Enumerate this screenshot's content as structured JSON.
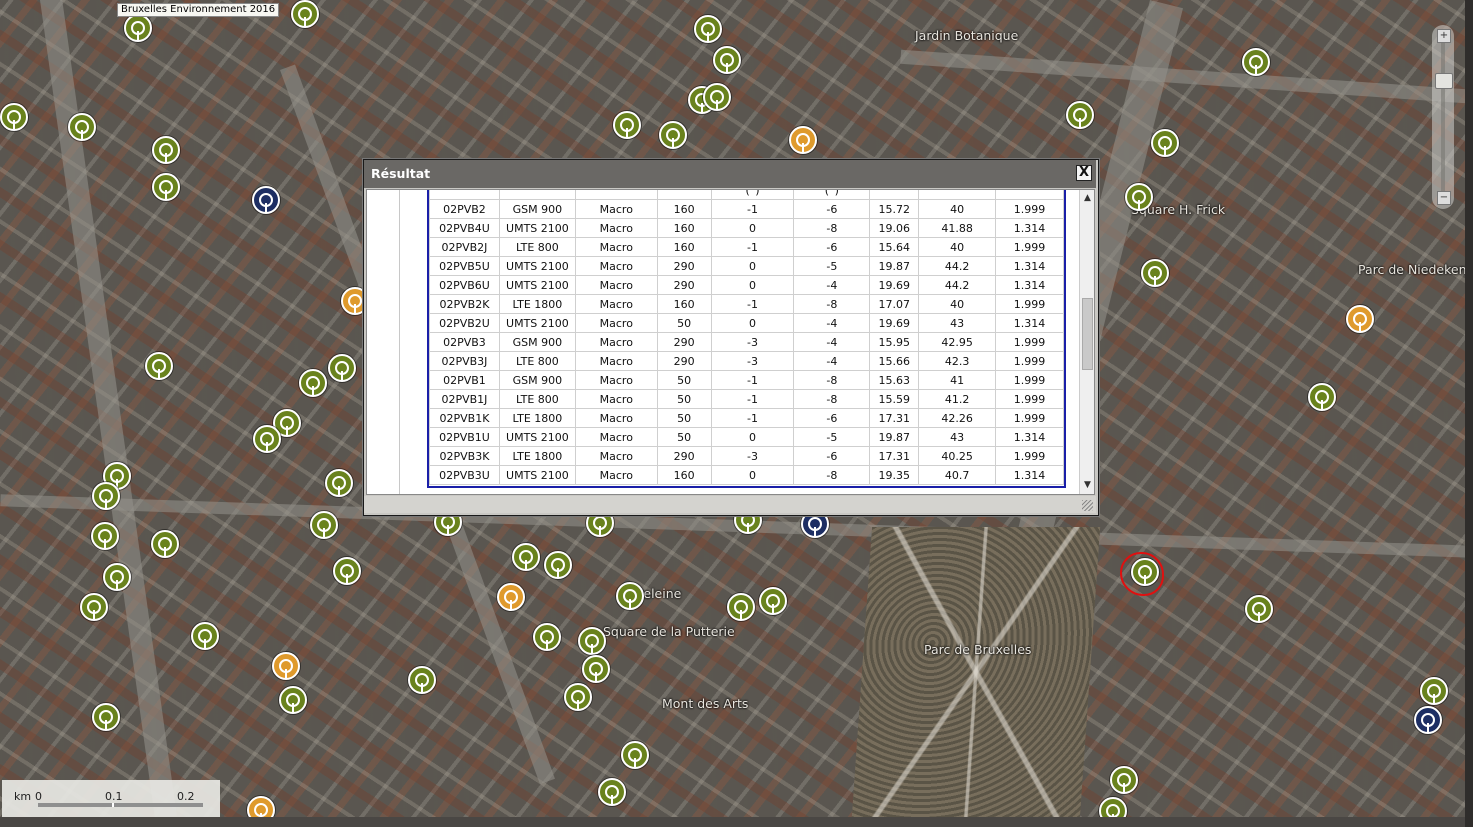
{
  "map": {
    "credit": "Bruxelles Environnement 2016",
    "labels": {
      "jardin": "Jardin Botanique",
      "square_frick": "Square H. Frick",
      "parc_niedeken": "Parc de Niedeken",
      "madeleine": "Madeleine",
      "square_putterie": "Square de la Putterie",
      "parc_bruxelles": "Parc de Bruxelles",
      "mont_arts": "Mont des Arts"
    },
    "scale": {
      "unit": "km",
      "t0": "0",
      "t1": "0.1",
      "t2": "0.2"
    },
    "colors": {
      "antenna_green": "#69821d",
      "antenna_orange": "#df9a2c",
      "antenna_blue": "#1d2e63",
      "highlight": "#e01010"
    }
  },
  "dialog": {
    "title": "Résultat",
    "close_label": "X",
    "header_fragments": {
      "tilt_e": "(°)",
      "tilt_m": "(°)"
    },
    "rows": [
      [
        "02PVB2",
        "GSM 900",
        "Macro",
        "160",
        "-1",
        "-6",
        "15.72",
        "40",
        "1.999"
      ],
      [
        "02PVB4U",
        "UMTS 2100",
        "Macro",
        "160",
        "0",
        "-8",
        "19.06",
        "41.88",
        "1.314"
      ],
      [
        "02PVB2J",
        "LTE 800",
        "Macro",
        "160",
        "-1",
        "-6",
        "15.64",
        "40",
        "1.999"
      ],
      [
        "02PVB5U",
        "UMTS 2100",
        "Macro",
        "290",
        "0",
        "-5",
        "19.87",
        "44.2",
        "1.314"
      ],
      [
        "02PVB6U",
        "UMTS 2100",
        "Macro",
        "290",
        "0",
        "-4",
        "19.69",
        "44.2",
        "1.314"
      ],
      [
        "02PVB2K",
        "LTE 1800",
        "Macro",
        "160",
        "-1",
        "-8",
        "17.07",
        "40",
        "1.999"
      ],
      [
        "02PVB2U",
        "UMTS 2100",
        "Macro",
        "50",
        "0",
        "-4",
        "19.69",
        "43",
        "1.314"
      ],
      [
        "02PVB3",
        "GSM 900",
        "Macro",
        "290",
        "-3",
        "-4",
        "15.95",
        "42.95",
        "1.999"
      ],
      [
        "02PVB3J",
        "LTE 800",
        "Macro",
        "290",
        "-3",
        "-4",
        "15.66",
        "42.3",
        "1.999"
      ],
      [
        "02PVB1",
        "GSM 900",
        "Macro",
        "50",
        "-1",
        "-8",
        "15.63",
        "41",
        "1.999"
      ],
      [
        "02PVB1J",
        "LTE 800",
        "Macro",
        "50",
        "-1",
        "-8",
        "15.59",
        "41.2",
        "1.999"
      ],
      [
        "02PVB1K",
        "LTE 1800",
        "Macro",
        "50",
        "-1",
        "-6",
        "17.31",
        "42.26",
        "1.999"
      ],
      [
        "02PVB1U",
        "UMTS 2100",
        "Macro",
        "50",
        "0",
        "-5",
        "19.87",
        "43",
        "1.314"
      ],
      [
        "02PVB3K",
        "LTE 1800",
        "Macro",
        "290",
        "-3",
        "-6",
        "17.31",
        "40.25",
        "1.999"
      ],
      [
        "02PVB3U",
        "UMTS 2100",
        "Macro",
        "160",
        "0",
        "-8",
        "19.35",
        "40.7",
        "1.314"
      ]
    ]
  }
}
